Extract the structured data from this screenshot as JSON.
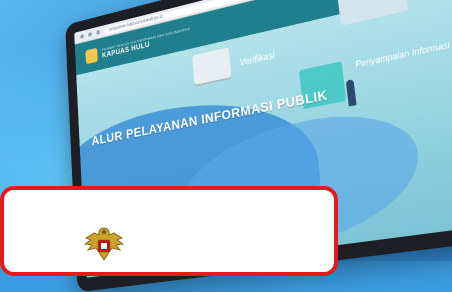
{
  "colors": {
    "background": "#3a9be0",
    "card_border": "#e8181f",
    "navbar": "#1f7f8c",
    "emblem_gold": "#c9a227"
  },
  "browser": {
    "url": "pelayanan.kapuashulukab.go.id"
  },
  "site": {
    "subtitle": "PEJABAT PENGELOLA INFORMASI DAN DOKUMENTASI",
    "title": "KAPUAS HULU",
    "search_icon": "search-icon"
  },
  "hero": {
    "title": "ALUR PELAYANAN INFORMASI PUBLIK",
    "verifikasi_label": "Verifikasi",
    "penyampaian_label": "Penyampaian Informasi"
  },
  "card": {
    "emblem_icon": "garuda-emblem-icon"
  }
}
